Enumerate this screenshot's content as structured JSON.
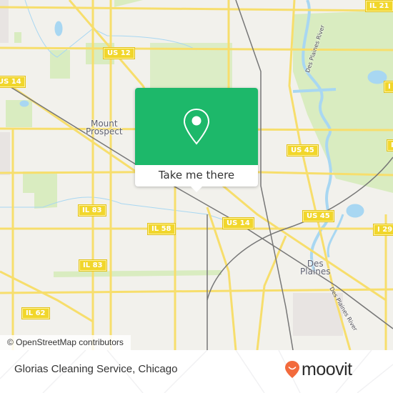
{
  "map": {
    "attribution": "© OpenStreetMap contributors",
    "places": [
      {
        "name": "Mount Prospect",
        "lines": [
          "Mount",
          "Prospect"
        ]
      },
      {
        "name": "Des Plaines",
        "lines": [
          "Des",
          "Plaines"
        ]
      }
    ],
    "river_labels": [
      "Des Plaines River",
      "Des Plaines River"
    ],
    "shields": [
      "IL 21",
      "US 12",
      "US 14",
      "US 45",
      "US 45",
      "I 29",
      "IL 83",
      "IL 58",
      "US 14",
      "IL 83",
      "IL 62",
      "I",
      "I"
    ],
    "colors": {
      "land": "#f2f1ec",
      "park": "#d9ecc0",
      "water": "#a8d7f2",
      "road": "#f7de6c",
      "rail": "#777777",
      "shield": "#f1d62b"
    }
  },
  "popup": {
    "icon": "map-pin-icon",
    "action_label": "Take me there",
    "color": "#1db86a"
  },
  "footer": {
    "location_title": "Glorias Cleaning Service, Chicago",
    "brand": "moovit",
    "brand_color": "#f26a3c"
  }
}
